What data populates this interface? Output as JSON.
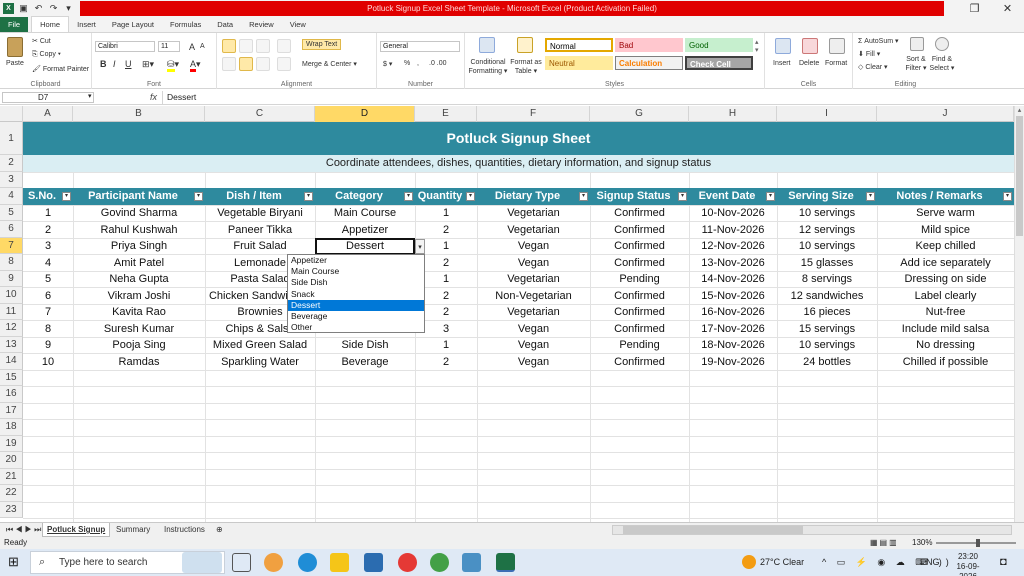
{
  "window": {
    "title": "Potluck Signup Excel Sheet Template - Microsoft Excel (Product Activation Failed)"
  },
  "ribbon": {
    "tabs": [
      "File",
      "Home",
      "Insert",
      "Page Layout",
      "Formulas",
      "Data",
      "Review",
      "View"
    ],
    "clipboard": {
      "paste": "Paste",
      "cut": "Cut",
      "copy": "Copy ▾",
      "format_painter": "Format Painter",
      "label": "Clipboard"
    },
    "font": {
      "name": "Calibri",
      "size": "11",
      "bold": "B",
      "italic": "I",
      "underline": "U",
      "grow": "A",
      "shrink": "A",
      "label": "Font"
    },
    "alignment": {
      "wrap_text": "Wrap Text",
      "merge_center": "Merge & Center ▾",
      "label": "Alignment"
    },
    "number": {
      "format": "General",
      "currency": "$ ▾",
      "percent": "%",
      "comma": ",",
      "label": "Number"
    },
    "styles": {
      "conditional_formatting": "Conditional Formatting ▾",
      "format_as_table": "Format as Table ▾",
      "cells": [
        {
          "label": "Normal",
          "bg": "#ffffff",
          "fg": "#000000",
          "border": "#e4a800"
        },
        {
          "label": "Bad",
          "bg": "#ffc7ce",
          "fg": "#9c0006",
          "border": "#ffc7ce"
        },
        {
          "label": "Good",
          "bg": "#c6efce",
          "fg": "#006100",
          "border": "#c6efce"
        },
        {
          "label": "Neutral",
          "bg": "#ffeb9c",
          "fg": "#9c5700",
          "border": "#ffeb9c"
        },
        {
          "label": "Calculation",
          "bg": "#f2f2f2",
          "fg": "#fa7d00",
          "border": "#7f7f7f"
        },
        {
          "label": "Check Cell",
          "bg": "#a5a5a5",
          "fg": "#ffffff",
          "border": "#3f3f3f"
        }
      ],
      "label": "Styles"
    },
    "cells": {
      "insert": "Insert",
      "delete": "Delete",
      "format": "Format",
      "label": "Cells"
    },
    "editing": {
      "autosum": "AutoSum ▾",
      "fill": "Fill ▾",
      "clear": "Clear ▾",
      "sort_filter": "Sort & Filter ▾",
      "find_select": "Find & Select ▾",
      "label": "Editing"
    }
  },
  "formula_bar": {
    "name_box": "D7",
    "fx": "fx",
    "content": "Dessert"
  },
  "grid": {
    "columns": [
      "A",
      "B",
      "C",
      "D",
      "E",
      "F",
      "G",
      "H",
      "I",
      "J"
    ],
    "selected_column": "D",
    "rows": [
      "1",
      "2",
      "3",
      "4",
      "5",
      "6",
      "7",
      "8",
      "9",
      "10",
      "11",
      "12",
      "13",
      "14",
      "15",
      "16",
      "17",
      "18",
      "19",
      "20",
      "21",
      "22",
      "23"
    ],
    "selected_row": "7"
  },
  "sheet": {
    "title": "Potluck Signup Sheet",
    "subtitle": "Coordinate attendees, dishes, quantities, dietary information, and signup status",
    "headers": [
      "S.No.",
      "Participant Name",
      "Dish / Item",
      "Category",
      "Quantity",
      "Dietary Type",
      "Signup Status",
      "Event Date",
      "Serving Size",
      "Notes / Remarks"
    ],
    "rows": [
      [
        "1",
        "Govind Sharma",
        "Vegetable Biryani",
        "Main Course",
        "1",
        "Vegetarian",
        "Confirmed",
        "10-Nov-2026",
        "10 servings",
        "Serve warm"
      ],
      [
        "2",
        "Rahul Kushwah",
        "Paneer Tikka",
        "Appetizer",
        "2",
        "Vegetarian",
        "Confirmed",
        "11-Nov-2026",
        "12 servings",
        "Mild spice"
      ],
      [
        "3",
        "Priya Singh",
        "Fruit Salad",
        "Dessert",
        "1",
        "Vegan",
        "Confirmed",
        "12-Nov-2026",
        "10 servings",
        "Keep chilled"
      ],
      [
        "4",
        "Amit Patel",
        "Lemonade",
        "",
        "2",
        "Vegan",
        "Confirmed",
        "13-Nov-2026",
        "15 glasses",
        "Add ice separately"
      ],
      [
        "5",
        "Neha Gupta",
        "Pasta Salad",
        "",
        "1",
        "Vegetarian",
        "Pending",
        "14-Nov-2026",
        "8 servings",
        "Dressing on side"
      ],
      [
        "6",
        "Vikram Joshi",
        "Chicken Sandwiches",
        "",
        "2",
        "Non-Vegetarian",
        "Confirmed",
        "15-Nov-2026",
        "12 sandwiches",
        "Label clearly"
      ],
      [
        "7",
        "Kavita Rao",
        "Brownies",
        "",
        "2",
        "Vegetarian",
        "Confirmed",
        "16-Nov-2026",
        "16 pieces",
        "Nut-free"
      ],
      [
        "8",
        "Suresh Kumar",
        "Chips & Salsa",
        "",
        "3",
        "Vegan",
        "Confirmed",
        "17-Nov-2026",
        "15 servings",
        "Include mild salsa"
      ],
      [
        "9",
        "Pooja Sing",
        "Mixed Green Salad",
        "Side Dish",
        "1",
        "Vegan",
        "Pending",
        "18-Nov-2026",
        "10 servings",
        "No dressing"
      ],
      [
        "10",
        "Ramdas",
        "Sparkling Water",
        "Beverage",
        "2",
        "Vegan",
        "Confirmed",
        "19-Nov-2026",
        "24 bottles",
        "Chilled if possible"
      ]
    ],
    "dropdown": {
      "options": [
        "Appetizer",
        "Main Course",
        "Side Dish",
        "Snack",
        "Dessert",
        "Beverage",
        "Other"
      ],
      "selected": "Dessert"
    },
    "colors": {
      "header_teal": "#2e8a9e",
      "subtitle_band": "#daeef3"
    }
  },
  "sheet_tabs": {
    "tabs": [
      "Potluck Signup",
      "Summary",
      "Instructions"
    ],
    "active": "Potluck Signup"
  },
  "status_bar": {
    "status": "Ready",
    "zoom": "130%"
  },
  "taskbar": {
    "search_placeholder": "Type here to search",
    "weather": "27°C  Clear",
    "language": "ENG",
    "time": "23:20",
    "date": "16-09-2026"
  }
}
